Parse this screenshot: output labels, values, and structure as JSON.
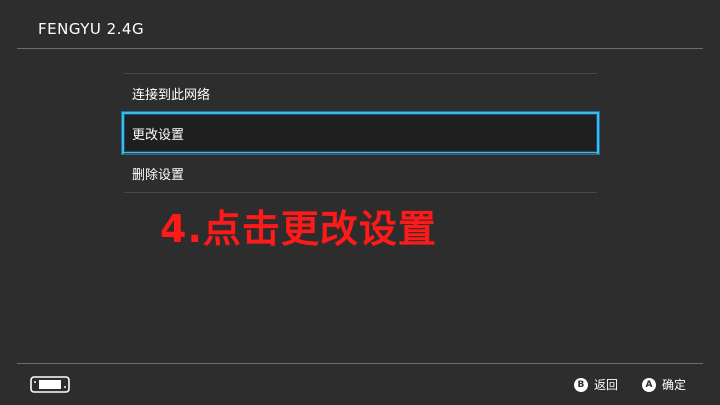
{
  "header": {
    "title": "FENGYU 2.4G"
  },
  "menu": {
    "items": [
      {
        "label": "连接到此网络"
      },
      {
        "label": "更改设置"
      },
      {
        "label": "删除设置"
      }
    ],
    "selected_index": 1
  },
  "annotation": {
    "text": "4.点击更改设置",
    "color": "#ff1a1a"
  },
  "footer": {
    "console_icon": "handheld-console-icon",
    "actions": [
      {
        "glyph": "B",
        "label": "返回"
      },
      {
        "glyph": "A",
        "label": "确定"
      }
    ]
  },
  "colors": {
    "background": "#2d2d2d",
    "selection_border": "#3fb8ea"
  }
}
